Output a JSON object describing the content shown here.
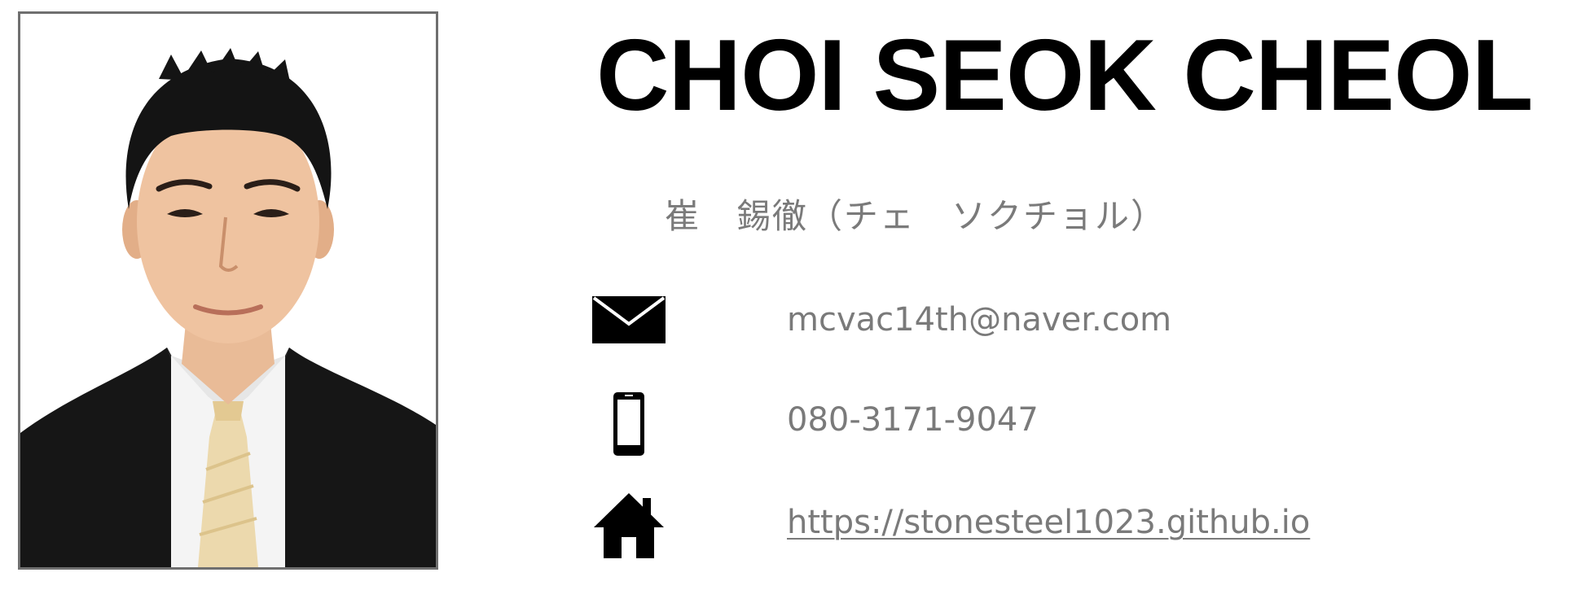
{
  "profile": {
    "name": "CHOI SEOK CHEOL",
    "native_name": "崔　錫徹（チェ　ソクチョル）"
  },
  "contacts": {
    "email": {
      "icon": "envelope-icon",
      "value": "mcvac14th@naver.com"
    },
    "phone": {
      "icon": "smartphone-icon",
      "value": "080-3171-9047"
    },
    "website": {
      "icon": "home-icon",
      "value": "https://stonesteel1023.github.io"
    }
  },
  "colors": {
    "text_primary": "#000000",
    "text_secondary": "#7a7a7a",
    "frame_border": "#6f6f6f"
  }
}
